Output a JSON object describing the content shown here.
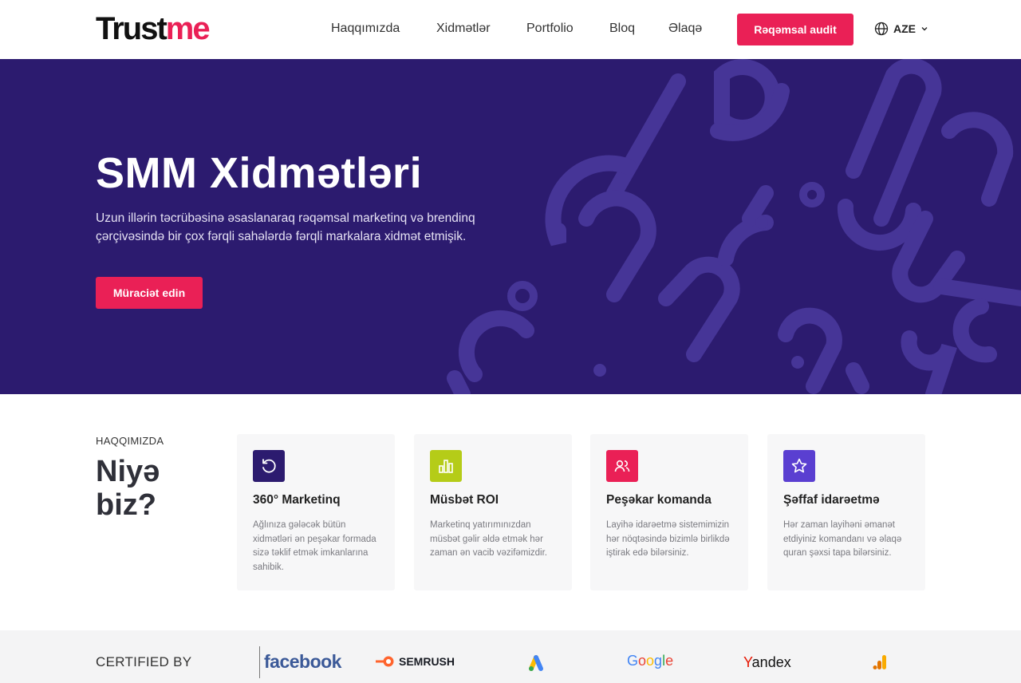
{
  "header": {
    "logo": {
      "part1": "Trust",
      "part2": "me"
    },
    "nav": [
      {
        "label": "Haqqımızda"
      },
      {
        "label": "Xidmətlər"
      },
      {
        "label": "Portfolio"
      },
      {
        "label": "Bloq"
      },
      {
        "label": "Əlaqə"
      }
    ],
    "cta_label": "Rəqəmsal audit",
    "language": "AZE"
  },
  "hero": {
    "title": "SMM Xidmətləri",
    "text": "Uzun illərin təcrübəsinə əsaslanaraq rəqəmsal marketinq və brendinq çərçivəsində bir çox fərqli sahələrdə fərqli markalara xidmət etmişik.",
    "button_label": "Müraciət edin"
  },
  "about": {
    "label": "HAQQIMIZDA",
    "title": "Niyə biz?",
    "cards": [
      {
        "icon": "refresh-icon",
        "color": "#2c1b6f",
        "title": "360° Marketinq",
        "text": "Ağlınıza gələcək bütün xidmətləri ən peşəkar formada sizə təklif etmək imkanlarına sahibik."
      },
      {
        "icon": "bar-chart-icon",
        "color": "#b5cc18",
        "title": "Müsbət ROI",
        "text": "Marketinq yatırımınızdan müsbət gəlir əldə etmək hər zaman ən vacib vəzifəmizdir."
      },
      {
        "icon": "users-icon",
        "color": "#ea2056",
        "title": "Peşəkar komanda",
        "text": "Layihə idarəetmə sistemimizin hər nöqtəsində bizimlə birlikdə iştirak edə bilərsiniz."
      },
      {
        "icon": "star-icon",
        "color": "#5a3fd1",
        "title": "Şəffaf idarəetmə",
        "text": "Hər zaman layihəni əmanət etdiyiniz komandanı və əlaqə quran şəxsi tapa bilərsiniz."
      }
    ]
  },
  "certified": {
    "label": "CERTIFIED BY",
    "brands": {
      "facebook": "facebook",
      "semrush": "SEMRUSH",
      "google_ads": "google-ads-logo",
      "google": "Google",
      "yandex": {
        "first": "Y",
        "rest": "andex"
      },
      "analytics": "google-analytics-logo"
    }
  },
  "colors": {
    "accent": "#ea2056",
    "hero_bg": "#2c1b6f",
    "pattern": "#463597"
  }
}
